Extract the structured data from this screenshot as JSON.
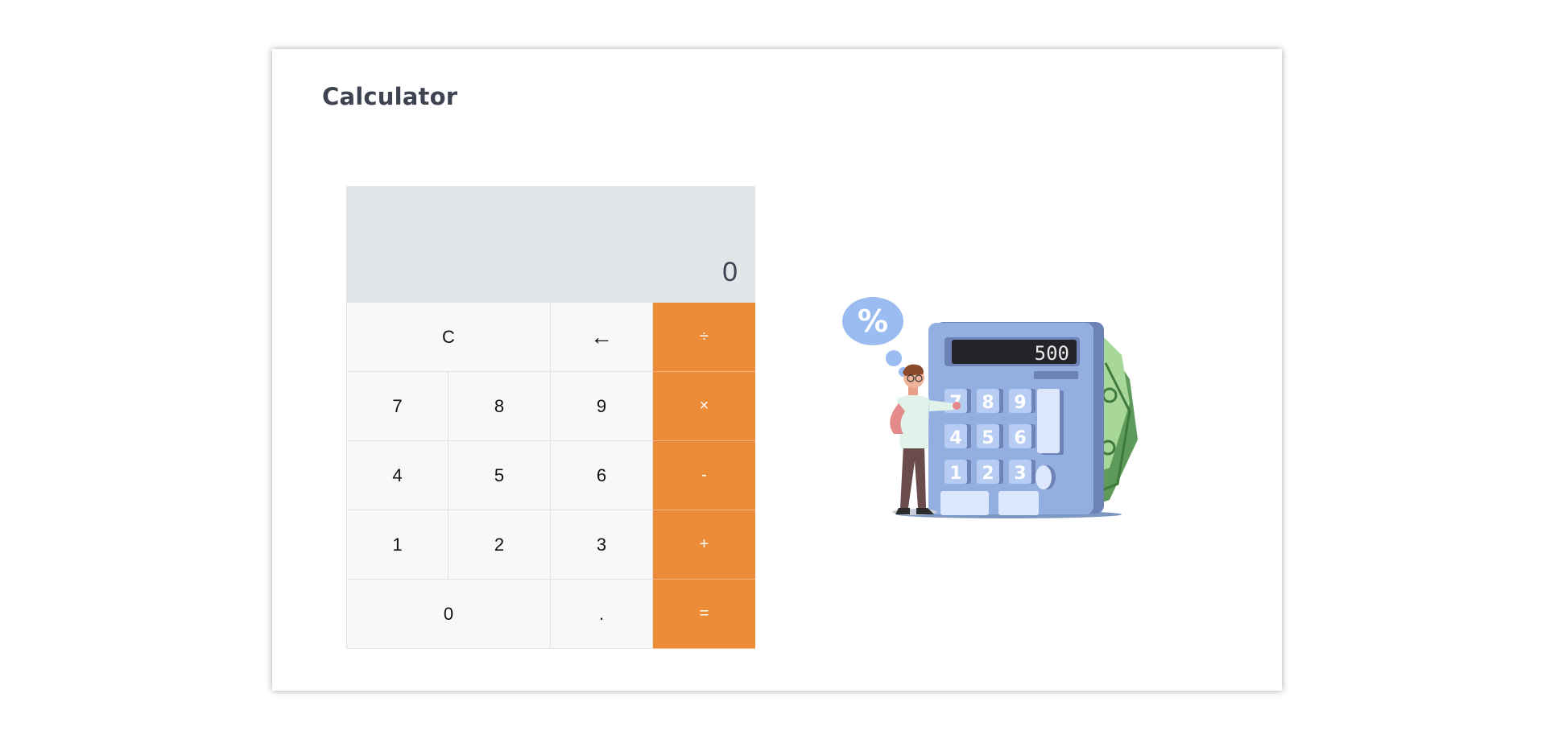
{
  "page": {
    "title": "Calculator"
  },
  "calculator": {
    "display": "0",
    "keys": {
      "clear": "C",
      "backspace": "←",
      "divide": "÷",
      "multiply": "×",
      "subtract": "-",
      "add": "+",
      "equals": "=",
      "decimal": ".",
      "d0": "0",
      "d1": "1",
      "d2": "2",
      "d3": "3",
      "d4": "4",
      "d5": "5",
      "d6": "6",
      "d7": "7",
      "d8": "8",
      "d9": "9"
    }
  },
  "illustration": {
    "bubble_symbol": "%",
    "screen_value": "500",
    "pad_keys": [
      "7",
      "8",
      "9",
      "4",
      "5",
      "6",
      "1",
      "2",
      "3"
    ]
  },
  "colors": {
    "accent": "#ec8c37",
    "display_bg": "#e3e6e8",
    "key_bg": "#f8f8f8",
    "title": "#3d4350",
    "illustration_calculator": "#93aee0",
    "money": "#6fa86a"
  }
}
